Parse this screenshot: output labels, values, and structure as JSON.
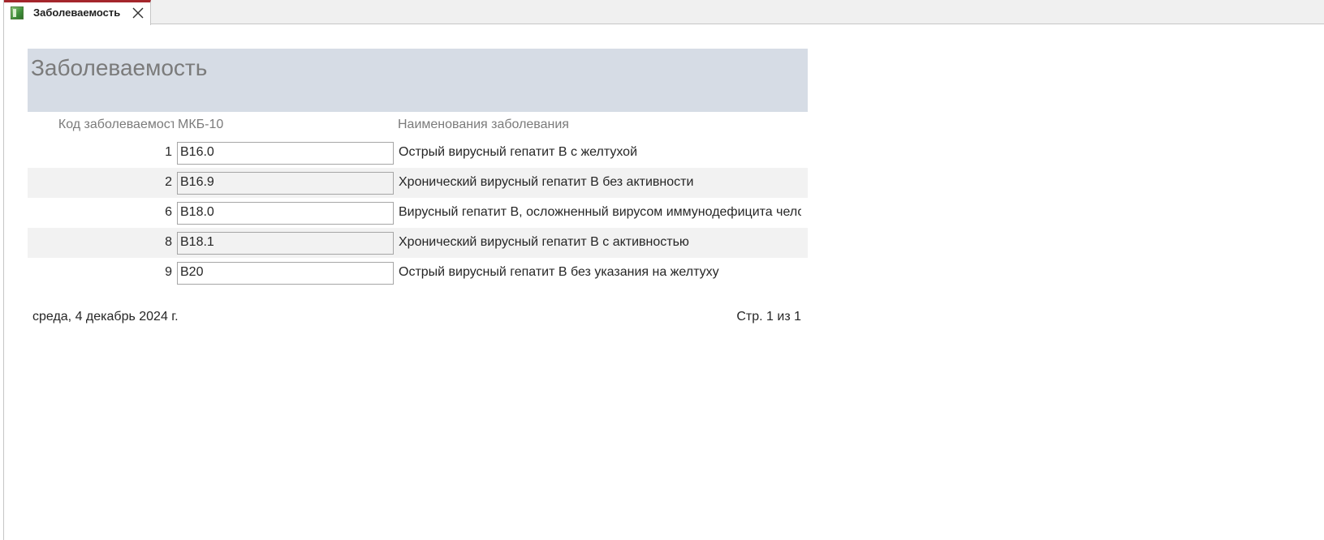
{
  "tab": {
    "label": "Заболеваемость",
    "icon": "report-icon",
    "close_icon": "close-icon"
  },
  "report": {
    "title": "Заболеваемость",
    "columns": {
      "code": "Код заболеваемости",
      "mkb": "МКБ-10",
      "name": "Наименования заболевания"
    },
    "rows": [
      {
        "num": "1",
        "mkb": "B16.0",
        "name": "Острый вирусный гепатит B с желтухой"
      },
      {
        "num": "2",
        "mkb": "B16.9",
        "name": "Хронический вирусный гепатит B без активности"
      },
      {
        "num": "6",
        "mkb": "B18.0",
        "name": "Вирусный гепатит B, осложненный вирусом иммунодефицита человека"
      },
      {
        "num": "8",
        "mkb": "B18.1",
        "name": "Хронический вирусный гепатит B с активностью"
      },
      {
        "num": "9",
        "mkb": "B20",
        "name": "Острый вирусный гепатит B без указания на желтуху"
      }
    ],
    "footer": {
      "date": "среда, 4 декабрь 2024 г.",
      "page": "Стр. 1 из 1"
    }
  },
  "colors": {
    "header_band": "#d6dce5",
    "alt_row": "#f2f2f2",
    "tab_accent": "#a4262c",
    "muted_text": "#7b7b7b"
  }
}
